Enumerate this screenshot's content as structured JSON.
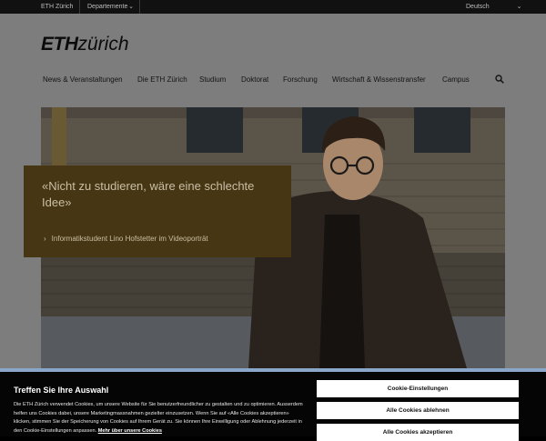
{
  "topbar": {
    "eth_link": "ETH Zürich",
    "departments_label": "Departemente",
    "language": "Deutsch"
  },
  "logo": {
    "eth": "ETH",
    "zurich": "zürich"
  },
  "nav": {
    "items": [
      "News & Veranstaltungen",
      "Die ETH Zürich",
      "Studium",
      "Doktorat",
      "Forschung",
      "Wirtschaft & Wissenstransfer",
      "Campus"
    ]
  },
  "hero": {
    "quote": "«Nicht zu studieren, wäre eine schlechte Idee»",
    "link": "Informatikstudent Lino Hofstetter im Videoporträt"
  },
  "cookie": {
    "title": "Treffen Sie Ihre Auswahl",
    "text": "Die ETH Zürich verwendet Cookies, um unsere Website für Sie benutzerfreundlicher zu gestalten und zu optimieren. Ausserdem helfen uns Cookies dabei, unsere Marketingmassnahmen gezielter einzusetzen. Wenn Sie auf «Alle Cookies akzeptieren» klicken, stimmen Sie der Speicherung von Cookies auf Ihrem Gerät zu. Sie können Ihre Einwilligung oder Ablehnung jederzeit in den Cookie-Einstellungen anpassen.",
    "more_link": "Mehr über unsere Cookies",
    "settings_button": "Cookie-Einstellungen",
    "reject_button": "Alle Cookies ablehnen",
    "accept_button": "Alle Cookies akzeptieren"
  },
  "colors": {
    "overlay_gray": "#7d7d7d",
    "teaser_brown": "#473613",
    "banner_border": "#8aa6c8"
  }
}
